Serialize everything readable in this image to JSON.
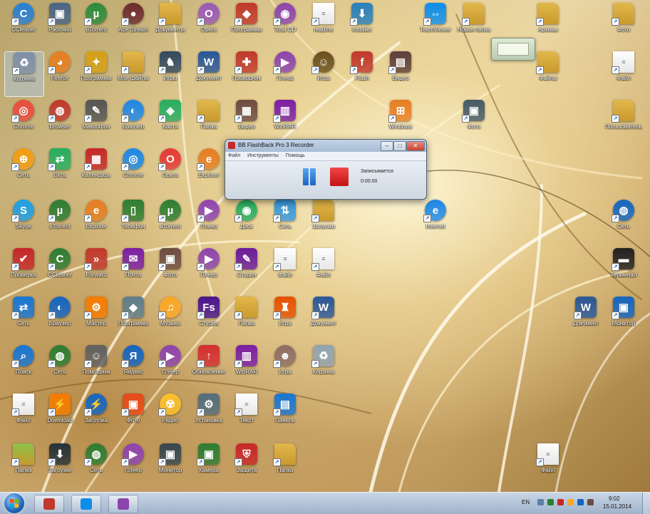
{
  "desktop": {
    "icons": [
      {
        "label": "CCleaner",
        "icon": "ccleaner-icon",
        "color": "#2a7fd4",
        "glyph": "C",
        "shape": "round"
      },
      {
        "label": "Рабочий",
        "icon": "computer-icon",
        "color": "#4b6584",
        "glyph": "▣",
        "shape": ""
      },
      {
        "label": "uTorrent",
        "icon": "utorrent-icon",
        "color": "#2e8b3a",
        "glyph": "µ",
        "shape": "round"
      },
      {
        "label": "Ace Stream",
        "icon": "media-icon",
        "color": "#6d2c2c",
        "glyph": "●",
        "shape": "round"
      },
      {
        "label": "Документы",
        "icon": "folder-icon",
        "color": "#e2b84b",
        "glyph": "",
        "shape": "fold"
      },
      {
        "label": "Opera",
        "icon": "opera-icon",
        "color": "#9b59b6",
        "glyph": "O",
        "shape": "round"
      },
      {
        "label": "Программы",
        "icon": "app-icon",
        "color": "#c0392b",
        "glyph": "◆",
        "shape": ""
      },
      {
        "label": "Total CD",
        "icon": "disc-icon",
        "color": "#8e44ad",
        "glyph": "◉",
        "shape": "round"
      },
      {
        "label": "readme",
        "icon": "document-icon",
        "color": "#ffffff",
        "glyph": "≡",
        "shape": "doc"
      },
      {
        "label": "Installer",
        "icon": "installer-icon",
        "color": "#2980b9",
        "glyph": "⬇",
        "shape": ""
      },
      {
        "label": "TeamViewer",
        "icon": "teamviewer-icon",
        "color": "#0e8ee9",
        "glyph": "⇔",
        "shape": ""
      },
      {
        "label": "Новая папка",
        "icon": "folder-icon",
        "color": "#e2b84b",
        "glyph": "",
        "shape": "fold"
      },
      {
        "label": "Архивы",
        "icon": "folder-icon",
        "color": "#e2b84b",
        "glyph": "",
        "shape": "fold"
      },
      {
        "label": "Фото",
        "icon": "folder-icon",
        "color": "#e2b84b",
        "glyph": "",
        "shape": "fold"
      },
      {
        "label": "Корзина",
        "icon": "recycle-icon",
        "color": "#7f8fa6",
        "glyph": "♻",
        "shape": ""
      },
      {
        "label": "Firefox",
        "icon": "firefox-icon",
        "color": "#e67e22",
        "glyph": "◕",
        "shape": "round"
      },
      {
        "label": "Программы",
        "icon": "app-icon",
        "color": "#d4a017",
        "glyph": "✦",
        "shape": ""
      },
      {
        "label": "Мои файлы",
        "icon": "folder-icon",
        "color": "#e2b84b",
        "glyph": "",
        "shape": "fold"
      },
      {
        "label": "Игры",
        "icon": "game-icon",
        "color": "#34495e",
        "glyph": "♞",
        "shape": ""
      },
      {
        "label": "Документ",
        "icon": "word-icon",
        "color": "#2b5797",
        "glyph": "W",
        "shape": ""
      },
      {
        "label": "Проводник",
        "icon": "app-icon",
        "color": "#c0392b",
        "glyph": "✚",
        "shape": ""
      },
      {
        "label": "Плеер",
        "icon": "player-icon",
        "color": "#8e44ad",
        "glyph": "▶",
        "shape": "round"
      },
      {
        "label": "Игра",
        "icon": "game-icon",
        "color": "#6b4f1d",
        "glyph": "☺",
        "shape": "round"
      },
      {
        "label": "Flash",
        "icon": "flash-icon",
        "color": "#c0392b",
        "glyph": "f",
        "shape": ""
      },
      {
        "label": "Видео",
        "icon": "video-icon",
        "color": "#5d4037",
        "glyph": "▤",
        "shape": ""
      },
      {
        "label": "Файлы",
        "icon": "folder-icon",
        "color": "#e2b84b",
        "glyph": "",
        "shape": "fold"
      },
      {
        "label": "Файл",
        "icon": "document-icon",
        "color": "#ffffff",
        "glyph": "≡",
        "shape": "doc"
      },
      {
        "label": "Chrome",
        "icon": "chrome-icon",
        "color": "#e74c3c",
        "glyph": "◎",
        "shape": "round"
      },
      {
        "label": "Browser",
        "icon": "browser-icon",
        "color": "#c0392b",
        "glyph": "◍",
        "shape": "round"
      },
      {
        "label": "Микрофон",
        "icon": "microphone-icon",
        "color": "#555555",
        "glyph": "✎",
        "shape": ""
      },
      {
        "label": "Браузер",
        "icon": "browser-icon",
        "color": "#1e88e5",
        "glyph": "◐",
        "shape": "round"
      },
      {
        "label": "Карта",
        "icon": "map-icon",
        "color": "#27ae60",
        "glyph": "◈",
        "shape": ""
      },
      {
        "label": "Папка",
        "icon": "folder-icon",
        "color": "#e2b84b",
        "glyph": "",
        "shape": "fold"
      },
      {
        "label": "Видео",
        "icon": "video-icon",
        "color": "#6d4c41",
        "glyph": "▦",
        "shape": ""
      },
      {
        "label": "WinRAR",
        "icon": "winrar-icon",
        "color": "#7b1fa2",
        "glyph": "▥",
        "shape": ""
      },
      {
        "label": "Windows",
        "icon": "windows-icon",
        "color": "#e67e22",
        "glyph": "⊞",
        "shape": ""
      },
      {
        "label": "Фото",
        "icon": "photo-icon",
        "color": "#455a64",
        "glyph": "▣",
        "shape": ""
      },
      {
        "label": "Пользователь",
        "icon": "user-folder-icon",
        "color": "#e2b84b",
        "glyph": "",
        "shape": "fold"
      },
      {
        "label": "Сеть",
        "icon": "globe-icon",
        "color": "#f39c12",
        "glyph": "⊕",
        "shape": "round"
      },
      {
        "label": "Сеть",
        "icon": "network-icon",
        "color": "#27ae60",
        "glyph": "⇄",
        "shape": ""
      },
      {
        "label": "Календарь",
        "icon": "calendar-icon",
        "color": "#c62828",
        "glyph": "▦",
        "shape": ""
      },
      {
        "label": "Chrome",
        "icon": "chrome-icon",
        "color": "#1e88e5",
        "glyph": "◎",
        "shape": "round"
      },
      {
        "label": "Opera",
        "icon": "opera-icon",
        "color": "#e53935",
        "glyph": "O",
        "shape": "round"
      },
      {
        "label": "Explorer",
        "icon": "ie-icon",
        "color": "#e67e22",
        "glyph": "e",
        "shape": "round"
      },
      {
        "label": "Skype",
        "icon": "skype-icon",
        "color": "#1e9fe3",
        "glyph": "S",
        "shape": "round"
      },
      {
        "label": "uTorrent",
        "icon": "utorrent-icon",
        "color": "#2e7d32",
        "glyph": "µ",
        "shape": "round"
      },
      {
        "label": "Explorer",
        "icon": "ie-icon",
        "color": "#e67e22",
        "glyph": "e",
        "shape": "round"
      },
      {
        "label": "Телефон",
        "icon": "phone-icon",
        "color": "#2e7d32",
        "glyph": "▯",
        "shape": ""
      },
      {
        "label": "uTorrent",
        "icon": "utorrent-icon",
        "color": "#2e7d32",
        "glyph": "µ",
        "shape": "round"
      },
      {
        "label": "Плеер",
        "icon": "player-icon",
        "color": "#8e44ad",
        "glyph": "▶",
        "shape": "round"
      },
      {
        "label": "Диск",
        "icon": "disc-icon",
        "color": "#27ae60",
        "glyph": "◉",
        "shape": "round"
      },
      {
        "label": "Сеть",
        "icon": "network-icon",
        "color": "#3498db",
        "glyph": "⇅",
        "shape": ""
      },
      {
        "label": "Загрузки",
        "icon": "folder-icon",
        "color": "#e2b84b",
        "glyph": "",
        "shape": "fold"
      },
      {
        "label": "Internet",
        "icon": "ie-icon",
        "color": "#1e88e5",
        "glyph": "e",
        "shape": "round"
      },
      {
        "label": "Сеть",
        "icon": "network-icon",
        "color": "#1565c0",
        "glyph": "◍",
        "shape": "round"
      },
      {
        "label": "Проверка",
        "icon": "check-icon",
        "color": "#c62828",
        "glyph": "✔",
        "shape": ""
      },
      {
        "label": "CCleaner",
        "icon": "ccleaner-icon",
        "color": "#2e7d32",
        "glyph": "C",
        "shape": "round"
      },
      {
        "label": "Forward",
        "icon": "arrow-icon",
        "color": "#c0392b",
        "glyph": "»",
        "shape": ""
      },
      {
        "label": "Почта",
        "icon": "mail-icon",
        "color": "#7b1fa2",
        "glyph": "✉",
        "shape": ""
      },
      {
        "label": "Фото",
        "icon": "photo-icon",
        "color": "#6d4c41",
        "glyph": "▣",
        "shape": ""
      },
      {
        "label": "Плеер",
        "icon": "player-icon",
        "color": "#8e44ad",
        "glyph": "▶",
        "shape": "round"
      },
      {
        "label": "Студия",
        "icon": "studio-icon",
        "color": "#6a1b9a",
        "glyph": "✎",
        "shape": ""
      },
      {
        "label": "Файл",
        "icon": "document-icon",
        "color": "#ffffff",
        "glyph": "≡",
        "shape": "doc"
      },
      {
        "label": "Файл",
        "icon": "document-icon",
        "color": "#ffffff",
        "glyph": "≡",
        "shape": "doc"
      },
      {
        "label": "Терминал",
        "icon": "terminal-icon",
        "color": "#212121",
        "glyph": "▬",
        "shape": ""
      },
      {
        "label": "Сеть",
        "icon": "network-icon",
        "color": "#1976d2",
        "glyph": "⇄",
        "shape": ""
      },
      {
        "label": "Браузер",
        "icon": "browser-icon",
        "color": "#1565c0",
        "glyph": "◐",
        "shape": "round"
      },
      {
        "label": "Мастер",
        "icon": "app-icon",
        "color": "#f57c00",
        "glyph": "⚙",
        "shape": ""
      },
      {
        "label": "Программа",
        "icon": "app-icon",
        "color": "#607d8b",
        "glyph": "◆",
        "shape": ""
      },
      {
        "label": "Музыка",
        "icon": "music-icon",
        "color": "#f9a825",
        "glyph": "♫",
        "shape": "round"
      },
      {
        "label": "Студия",
        "icon": "studio-icon",
        "color": "#4a148c",
        "glyph": "Fs",
        "shape": ""
      },
      {
        "label": "Папка",
        "icon": "folder-icon",
        "color": "#e2b84b",
        "glyph": "",
        "shape": "fold"
      },
      {
        "label": "Игра",
        "icon": "game-icon",
        "color": "#e65100",
        "glyph": "♜",
        "shape": ""
      },
      {
        "label": "Документ",
        "icon": "word-icon",
        "color": "#2b5797",
        "glyph": "W",
        "shape": ""
      },
      {
        "label": "Документ",
        "icon": "word-icon",
        "color": "#2b5797",
        "glyph": "W",
        "shape": ""
      },
      {
        "label": "Монитор",
        "icon": "monitor-icon",
        "color": "#1565c0",
        "glyph": "▣",
        "shape": ""
      },
      {
        "label": "Поиск",
        "icon": "search-icon",
        "color": "#1976d2",
        "glyph": "⌕",
        "shape": "round"
      },
      {
        "label": "Сеть",
        "icon": "network-icon",
        "color": "#2e7d32",
        "glyph": "◍",
        "shape": "round"
      },
      {
        "label": "Помощник",
        "icon": "app-icon",
        "color": "#616161",
        "glyph": "☺",
        "shape": ""
      },
      {
        "label": "Яндекс",
        "icon": "yandex-icon",
        "color": "#1565c0",
        "glyph": "Я",
        "shape": "round"
      },
      {
        "label": "Плеер",
        "icon": "player-icon",
        "color": "#8e44ad",
        "glyph": "▶",
        "shape": "round"
      },
      {
        "label": "Обновление",
        "icon": "update-icon",
        "color": "#d32f2f",
        "glyph": "↑",
        "shape": ""
      },
      {
        "label": "WinRAR",
        "icon": "winrar-icon",
        "color": "#7b1fa2",
        "glyph": "▥",
        "shape": ""
      },
      {
        "label": "Игра",
        "icon": "game-icon",
        "color": "#8d6e63",
        "glyph": "☻",
        "shape": "round"
      },
      {
        "label": "Корзина",
        "icon": "recycle-icon",
        "color": "#90a4ae",
        "glyph": "♻",
        "shape": ""
      },
      {
        "label": "Файл",
        "icon": "document-icon",
        "color": "#ffffff",
        "glyph": "≡",
        "shape": "doc"
      },
      {
        "label": "Download",
        "icon": "download-icon",
        "color": "#f57c00",
        "glyph": "⚡",
        "shape": ""
      },
      {
        "label": "Загрузка",
        "icon": "download-icon",
        "color": "#1565c0",
        "glyph": "⚡",
        "shape": "round"
      },
      {
        "label": "Фото",
        "icon": "photo-icon",
        "color": "#e64a19",
        "glyph": "▣",
        "shape": ""
      },
      {
        "label": "Радио",
        "icon": "radio-icon",
        "color": "#fbc02d",
        "glyph": "☢",
        "shape": "round"
      },
      {
        "label": "Установка",
        "icon": "installer-icon",
        "color": "#546e7a",
        "glyph": "⚙",
        "shape": ""
      },
      {
        "label": "Текст",
        "icon": "document-icon",
        "color": "#ffffff",
        "glyph": "≡",
        "shape": "doc"
      },
      {
        "label": "Панель",
        "icon": "panel-icon",
        "color": "#1976d2",
        "glyph": "▤",
        "shape": ""
      },
      {
        "label": "Папка",
        "icon": "folder-icon",
        "color": "#8bc34a",
        "glyph": "",
        "shape": "fold"
      },
      {
        "label": "Загрузки",
        "icon": "terminal-icon",
        "color": "#263238",
        "glyph": "⬇",
        "shape": ""
      },
      {
        "label": "Сеть",
        "icon": "globe-icon",
        "color": "#2e7d32",
        "glyph": "◍",
        "shape": "round"
      },
      {
        "label": "Плеер",
        "icon": "player-icon",
        "color": "#8e44ad",
        "glyph": "▶",
        "shape": "round"
      },
      {
        "label": "Монитор",
        "icon": "monitor-icon",
        "color": "#37474f",
        "glyph": "▣",
        "shape": ""
      },
      {
        "label": "Камера",
        "icon": "camera-icon",
        "color": "#2e7d32",
        "glyph": "▣",
        "shape": ""
      },
      {
        "label": "Защита",
        "icon": "shield-icon",
        "color": "#c62828",
        "glyph": "⛨",
        "shape": ""
      },
      {
        "label": "Папка",
        "icon": "folder-icon",
        "color": "#e2b84b",
        "glyph": "",
        "shape": "fold"
      },
      {
        "label": "Файл",
        "icon": "document-icon",
        "color": "#ffffff",
        "glyph": "≡",
        "shape": "doc"
      }
    ]
  },
  "recorder": {
    "title": "BB FlashBack Pro 3 Recorder",
    "menu": [
      "Файл",
      "Инструменты",
      "Помощь"
    ],
    "status": "Записывается",
    "time": "0:00:00",
    "min": "–",
    "max": "□",
    "close": "✕"
  },
  "taskbar": {
    "lang": "EN",
    "time": "9:02",
    "date": "15.01.2014",
    "pinned": [
      {
        "name": "taskbar-app-program",
        "color": "#c0392b"
      },
      {
        "name": "taskbar-app-teamviewer",
        "color": "#0e8ee9"
      },
      {
        "name": "taskbar-app-recorder",
        "color": "#8e44ad"
      }
    ]
  }
}
